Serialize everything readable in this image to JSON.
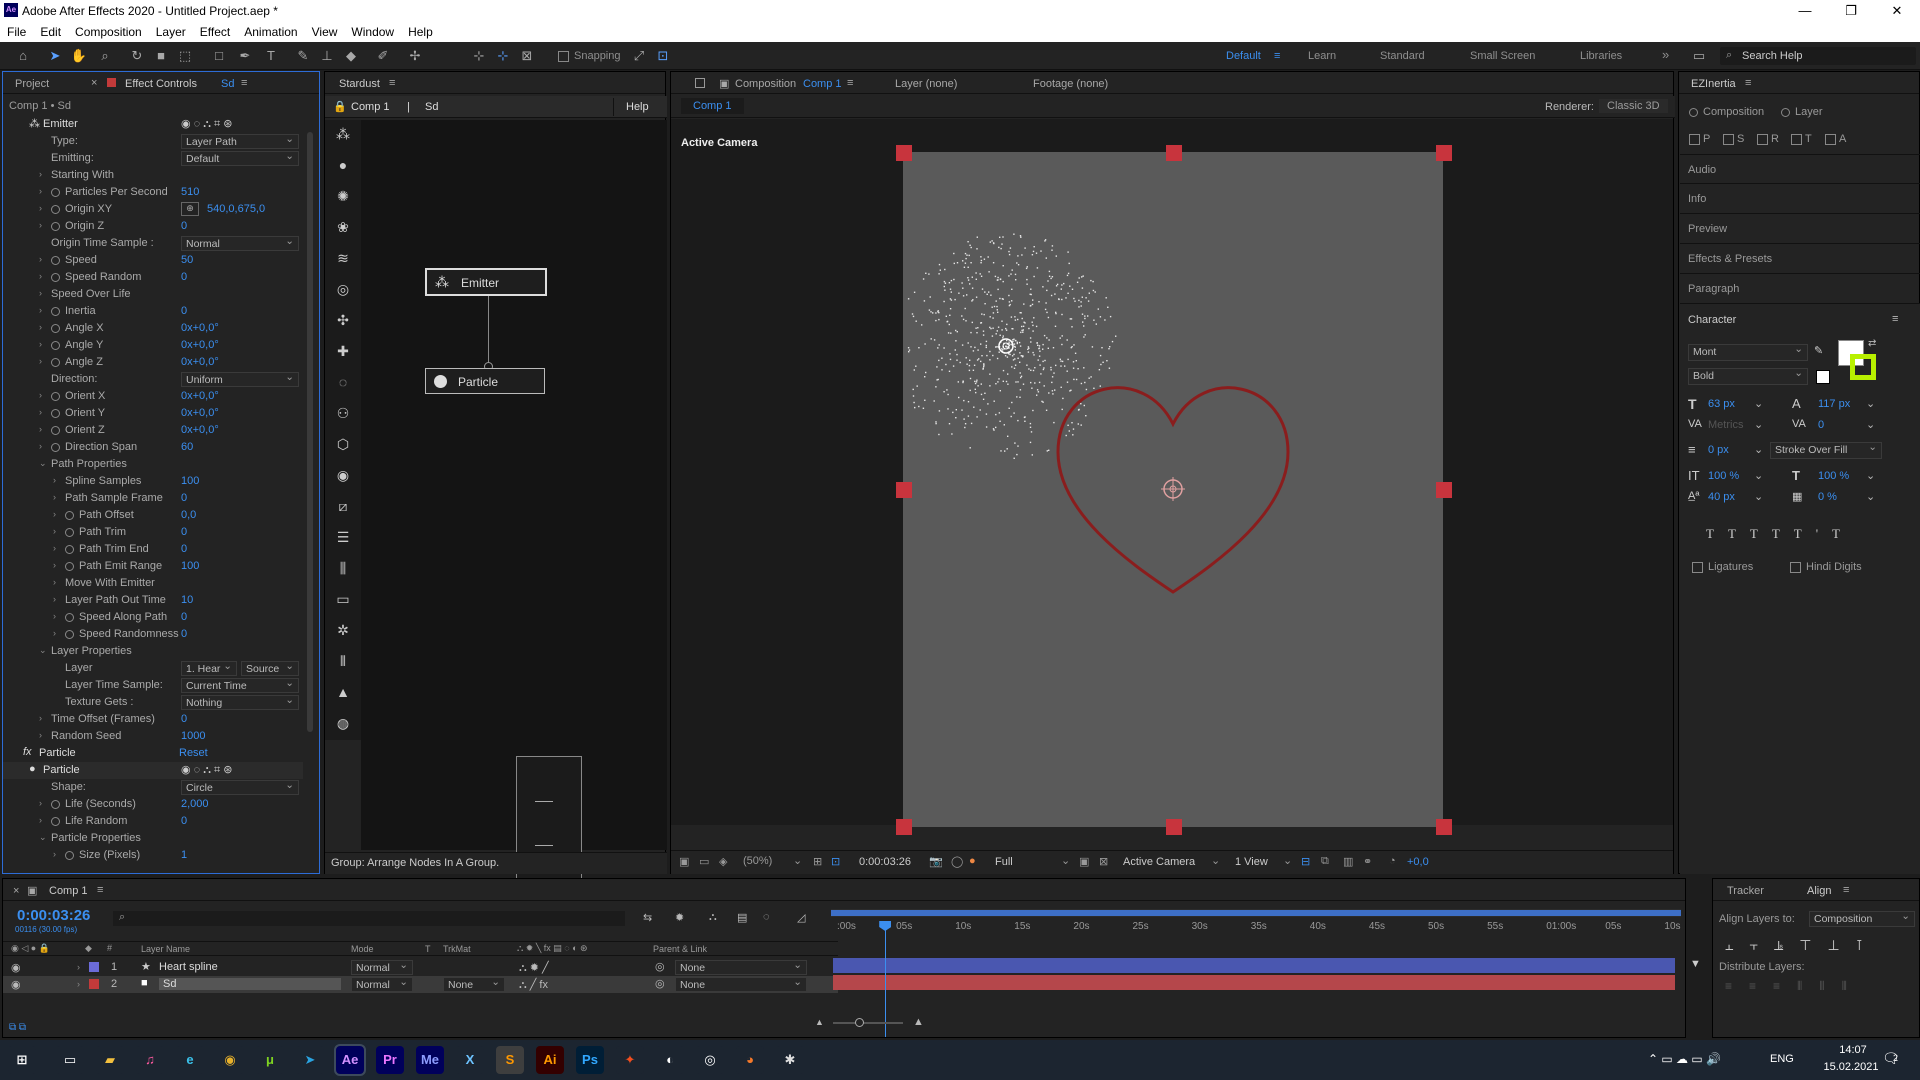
{
  "app": {
    "title": "Adobe After Effects 2020 - Untitled Project.aep *",
    "logo": "Ae"
  },
  "window_controls": {
    "minimize": "—",
    "restore": "❐",
    "close": "✕"
  },
  "menu": [
    "File",
    "Edit",
    "Composition",
    "Layer",
    "Effect",
    "Animation",
    "View",
    "Window",
    "Help"
  ],
  "toolbar": {
    "snapping": "Snapping",
    "workspaces": [
      "Default",
      "Learn",
      "Standard",
      "Small Screen",
      "Libraries"
    ],
    "more": "»",
    "search_placeholder": "Search Help"
  },
  "project_panel": {
    "tab_project": "Project",
    "tab_effect_controls": "Effect Controls",
    "layer_name": "Sd",
    "breadcrumb": "Comp 1 • Sd"
  },
  "effect_rows": [
    {
      "indent": 0,
      "label": "Emitter",
      "icon": "emitter-icon",
      "value": "",
      "type": "header"
    },
    {
      "indent": 1,
      "label": "Type:",
      "value": "Layer Path",
      "type": "dropdown"
    },
    {
      "indent": 1,
      "label": "Emitting:",
      "value": "Default",
      "type": "dropdown"
    },
    {
      "indent": 1,
      "label": "Starting With",
      "value": "",
      "type": "group"
    },
    {
      "indent": 1,
      "label": "Particles Per Second",
      "value": "510",
      "type": "stopwatch"
    },
    {
      "indent": 1,
      "label": "Origin XY",
      "value": "540,0,675,0",
      "type": "point"
    },
    {
      "indent": 1,
      "label": "Origin Z",
      "value": "0",
      "type": "stopwatch"
    },
    {
      "indent": 1,
      "label": "Origin Time Sample :",
      "value": "Normal",
      "type": "dropdown"
    },
    {
      "indent": 1,
      "label": "Speed",
      "value": "50",
      "type": "stopwatch"
    },
    {
      "indent": 1,
      "label": "Speed Random",
      "value": "0",
      "type": "stopwatch"
    },
    {
      "indent": 1,
      "label": "Speed Over Life",
      "value": "",
      "type": "group"
    },
    {
      "indent": 1,
      "label": "Inertia",
      "value": "0",
      "type": "stopwatch"
    },
    {
      "indent": 1,
      "label": "Angle X",
      "value": "0x+0,0°",
      "type": "stopwatch"
    },
    {
      "indent": 1,
      "label": "Angle Y",
      "value": "0x+0,0°",
      "type": "stopwatch"
    },
    {
      "indent": 1,
      "label": "Angle Z",
      "value": "0x+0,0°",
      "type": "stopwatch"
    },
    {
      "indent": 1,
      "label": "Direction:",
      "value": "Uniform",
      "type": "dropdown"
    },
    {
      "indent": 1,
      "label": "Orient X",
      "value": "0x+0,0°",
      "type": "stopwatch"
    },
    {
      "indent": 1,
      "label": "Orient Y",
      "value": "0x+0,0°",
      "type": "stopwatch"
    },
    {
      "indent": 1,
      "label": "Orient Z",
      "value": "0x+0,0°",
      "type": "stopwatch"
    },
    {
      "indent": 1,
      "label": "Direction Span",
      "value": "60",
      "type": "stopwatch"
    },
    {
      "indent": 1,
      "label": "Path Properties",
      "value": "",
      "type": "open"
    },
    {
      "indent": 2,
      "label": "Spline Samples",
      "value": "100",
      "type": "plain"
    },
    {
      "indent": 2,
      "label": "Path Sample Frame",
      "value": "0",
      "type": "plain"
    },
    {
      "indent": 2,
      "label": "Path Offset",
      "value": "0,0",
      "type": "stopwatch"
    },
    {
      "indent": 2,
      "label": "Path Trim",
      "value": "0",
      "type": "stopwatch"
    },
    {
      "indent": 2,
      "label": "Path Trim End",
      "value": "0",
      "type": "stopwatch"
    },
    {
      "indent": 2,
      "label": "Path Emit Range",
      "value": "100",
      "type": "stopwatch"
    },
    {
      "indent": 2,
      "label": "Move With Emitter",
      "value": "",
      "type": "group"
    },
    {
      "indent": 2,
      "label": "Layer Path Out Time",
      "value": "10",
      "type": "plain"
    },
    {
      "indent": 2,
      "label": "Speed Along Path",
      "value": "0",
      "type": "stopwatch"
    },
    {
      "indent": 2,
      "label": "Speed Randomness",
      "value": "0",
      "type": "stopwatch"
    },
    {
      "indent": 1,
      "label": "Layer Properties",
      "value": "",
      "type": "open"
    },
    {
      "indent": 2,
      "label": "Layer",
      "value": "1. Hear",
      "value2": "Source",
      "type": "dropdown2"
    },
    {
      "indent": 2,
      "label": "Layer Time Sample:",
      "value": "Current Time",
      "type": "dropdown"
    },
    {
      "indent": 2,
      "label": "Texture Gets :",
      "value": "Nothing",
      "type": "dropdown"
    },
    {
      "indent": 1,
      "label": "Time Offset (Frames)",
      "value": "0",
      "type": "group"
    },
    {
      "indent": 1,
      "label": "Random Seed",
      "value": "1000",
      "type": "group"
    },
    {
      "indent": 0,
      "label": "Particle",
      "value": "Reset",
      "type": "fx"
    },
    {
      "indent": 0,
      "label": "Particle",
      "icon": "particle-icon",
      "value": "",
      "type": "header2"
    },
    {
      "indent": 1,
      "label": "Shape:",
      "value": "Circle",
      "type": "dropdown"
    },
    {
      "indent": 1,
      "label": "Life (Seconds)",
      "value": "2,000",
      "type": "stopwatch"
    },
    {
      "indent": 1,
      "label": "Life Random",
      "value": "0",
      "type": "stopwatch"
    },
    {
      "indent": 1,
      "label": "Particle Properties",
      "value": "",
      "type": "open"
    },
    {
      "indent": 2,
      "label": "Size (Pixels)",
      "value": "1",
      "type": "stopwatch"
    }
  ],
  "stardust": {
    "title": "Stardust",
    "comp": "Comp 1",
    "layer": "Sd",
    "help": "Help",
    "node_emitter": "Emitter",
    "node_particle": "Particle",
    "status": "Group: Arrange Nodes In A Group."
  },
  "composition": {
    "tab_label": "Composition",
    "comp_name": "Comp 1",
    "layer_tab": "Layer (none)",
    "footage_tab": "Footage (none)",
    "subtab": "Comp 1",
    "renderer_label": "Renderer:",
    "renderer": "Classic 3D",
    "active_camera": "Active Camera",
    "zoom": "(50%)",
    "timecode": "0:00:03:26",
    "resolution": "Full",
    "camera_select": "Active Camera",
    "view_select": "1 View",
    "exposure": "+0,0"
  },
  "right_panel": {
    "ezinertia": "EZInertia",
    "radio_comp": "Composition",
    "radio_layer": "Layer",
    "checks": [
      "P",
      "S",
      "R",
      "T",
      "A"
    ],
    "sections": [
      "Audio",
      "Info",
      "Preview",
      "Effects & Presets",
      "Paragraph"
    ],
    "character": "Character",
    "font": "Mont",
    "style": "Bold",
    "size": "63 px",
    "leading": "117 px",
    "kerning": "Metrics",
    "tracking": "0",
    "stroke": "0 px",
    "stroke_mode": "Stroke Over Fill",
    "vscale": "100 %",
    "hscale": "100 %",
    "baseline": "40 px",
    "tsume": "0 %",
    "ligatures": "Ligatures",
    "hindi": "Hindi Digits",
    "fill_color": "#ffffff",
    "stroke_color": "#b8f000"
  },
  "timeline": {
    "tab": "Comp 1",
    "timecode": "0:00:03:26",
    "frame_info": "00116 (30.00 fps)",
    "columns": {
      "name": "Layer Name",
      "mode": "Mode",
      "t": "T",
      "trkmat": "TrkMat",
      "parent": "Parent & Link"
    },
    "ruler": [
      ":00s",
      "05s",
      "10s",
      "15s",
      "20s",
      "25s",
      "30s",
      "35s",
      "40s",
      "45s",
      "50s",
      "55s",
      "01:00s",
      "05s",
      "10s"
    ],
    "layers": [
      {
        "num": "1",
        "name": "Heart spline",
        "mode": "Normal",
        "trkmat": "",
        "parent": "None",
        "color": "#6b6bd8",
        "bar": "#4a57b0"
      },
      {
        "num": "2",
        "name": "Sd",
        "mode": "Normal",
        "trkmat": "None",
        "parent": "None",
        "color": "#c23a3a",
        "bar": "#b5474b"
      }
    ],
    "playhead_fraction": 0.062
  },
  "tracker": {
    "tab_tracker": "Tracker",
    "tab_align": "Align",
    "align_to_label": "Align Layers to:",
    "align_to": "Composition",
    "distribute": "Distribute Layers:"
  },
  "taskbar": {
    "apps": [
      {
        "name": "start-icon",
        "glyph": "⊞",
        "bg": "#1c2530",
        "fg": "#fff"
      },
      {
        "name": "task-view-icon",
        "glyph": "▭",
        "bg": "#1c2530",
        "fg": "#fff"
      },
      {
        "name": "file-explorer-icon",
        "glyph": "▰",
        "bg": "#1c2530",
        "fg": "#f3c03e"
      },
      {
        "name": "itunes-icon",
        "glyph": "♫",
        "bg": "#1c2530",
        "fg": "#ff5aa0"
      },
      {
        "name": "edge-icon",
        "glyph": "e",
        "bg": "#1c2530",
        "fg": "#3ac0e8"
      },
      {
        "name": "chrome-icon",
        "glyph": "◉",
        "bg": "#1c2530",
        "fg": "#e7b12b"
      },
      {
        "name": "utorrent-icon",
        "glyph": "μ",
        "bg": "#1c2530",
        "fg": "#7ed321"
      },
      {
        "name": "telegram-icon",
        "glyph": "➤",
        "bg": "#1c2530",
        "fg": "#2aa3e0"
      },
      {
        "name": "after-effects-icon",
        "glyph": "Ae",
        "bg": "#00005b",
        "fg": "#d291ff"
      },
      {
        "name": "premiere-icon",
        "glyph": "Pr",
        "bg": "#00005b",
        "fg": "#ea77ff"
      },
      {
        "name": "media-encoder-icon",
        "glyph": "Me",
        "bg": "#00005b",
        "fg": "#8d9cff"
      },
      {
        "name": "xd-like-icon",
        "glyph": "X",
        "bg": "#1c2530",
        "fg": "#6dc3ff"
      },
      {
        "name": "sublime-icon",
        "glyph": "S",
        "bg": "#3e3e3e",
        "fg": "#ff9800"
      },
      {
        "name": "illustrator-icon",
        "glyph": "Ai",
        "bg": "#330000",
        "fg": "#ff9a00"
      },
      {
        "name": "photoshop-icon",
        "glyph": "Ps",
        "bg": "#001e36",
        "fg": "#31a8ff"
      },
      {
        "name": "figma-icon",
        "glyph": "✦",
        "bg": "#1c2530",
        "fg": "#f24e1e"
      },
      {
        "name": "cinema4d-icon",
        "glyph": "◐",
        "bg": "#1c2530",
        "fg": "#fff"
      },
      {
        "name": "steam-like-icon",
        "glyph": "◎",
        "bg": "#1c2530",
        "fg": "#fff"
      },
      {
        "name": "blender-icon",
        "glyph": "◕",
        "bg": "#1c2530",
        "fg": "#f5792a"
      },
      {
        "name": "spider-icon",
        "glyph": "✱",
        "bg": "#1c2530",
        "fg": "#ddd"
      }
    ],
    "lang": "ENG",
    "time": "14:07",
    "date": "15.02.2021",
    "notifications": "2"
  }
}
